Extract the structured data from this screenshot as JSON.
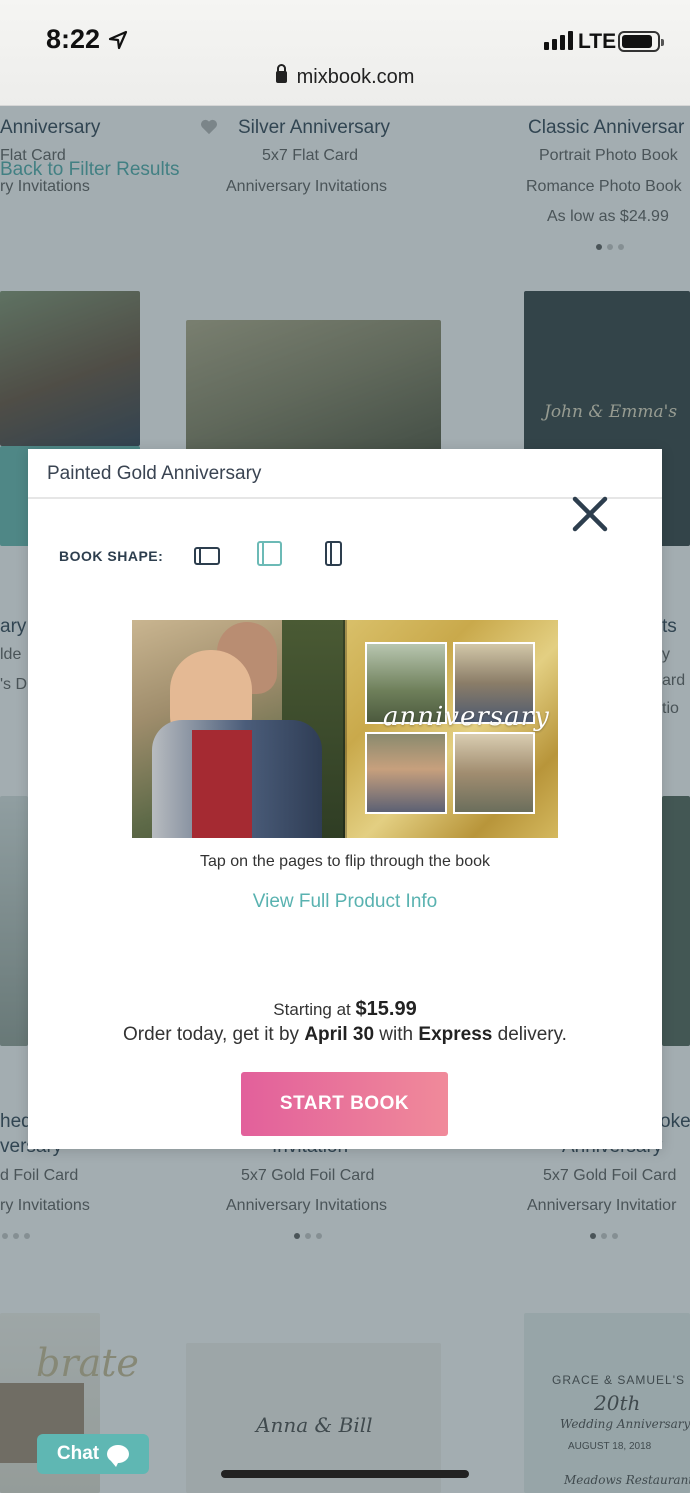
{
  "status_bar": {
    "time": "8:22",
    "network": "LTE",
    "url": "mixbook.com"
  },
  "background": {
    "back_link": "Back to Filter Results",
    "row1": [
      {
        "name": "Anniversary",
        "sub1": "Flat Card",
        "sub2": "ry Invitations"
      },
      {
        "name": "Silver Anniversary",
        "sub1": "5x7 Flat Card",
        "sub2": "Anniversary Invitations"
      },
      {
        "name": "Classic Anniversar",
        "sub1": "Portrait Photo Book",
        "sub2": "Romance Photo Book",
        "price": "As low as $24.99"
      }
    ],
    "row2_left": [
      "ary",
      "lde",
      "'s D"
    ],
    "row2_right": [
      "ts",
      "y",
      "ard",
      "tio"
    ],
    "row3": [
      {
        "name": "hed",
        "name2": "versary",
        "sub1": "d Foil Card",
        "sub2": "ry Invitations"
      },
      {
        "name": "Invitation",
        "sub1": "5x7 Gold Foil Card",
        "sub2": "Anniversary Invitations"
      },
      {
        "name": "oke",
        "name2": "Anniversary",
        "sub1": "5x7 Gold Foil Card",
        "sub2": "Anniversary Invitatior"
      }
    ],
    "card_text": {
      "card1_line1": "Anna & Bill",
      "card2_line1": "GRACE & SAMUEL'S",
      "card2_line2": "20th",
      "card2_line3": "Wedding Anniversary",
      "card2_line4": "AUGUST 18, 2018",
      "card2_line5": "Meadows Restaurant",
      "card3": "John & Emma's",
      "card4": "brate"
    }
  },
  "modal": {
    "title": "Painted Gold Anniversary",
    "book_shape_label": "BOOK SHAPE:",
    "shapes": [
      "landscape",
      "square",
      "portrait"
    ],
    "selected_shape": "square",
    "book_overlay_text": "anniversary",
    "hint": "Tap on the pages to flip through the book",
    "full_info_link": "View Full Product Info",
    "price_prefix": "Starting at ",
    "price": "$15.99",
    "order_prefix": "Order today, get it by ",
    "order_date": "April 30",
    "order_mid": " with ",
    "order_speed": "Express",
    "order_suffix": " delivery.",
    "start_button": "START BOOK"
  },
  "chat": {
    "label": "Chat"
  },
  "colors": {
    "accent_teal": "#59b2b0",
    "cta_start": "#e2609b",
    "cta_end": "#f08a9a",
    "navy": "#2d3e4e"
  }
}
